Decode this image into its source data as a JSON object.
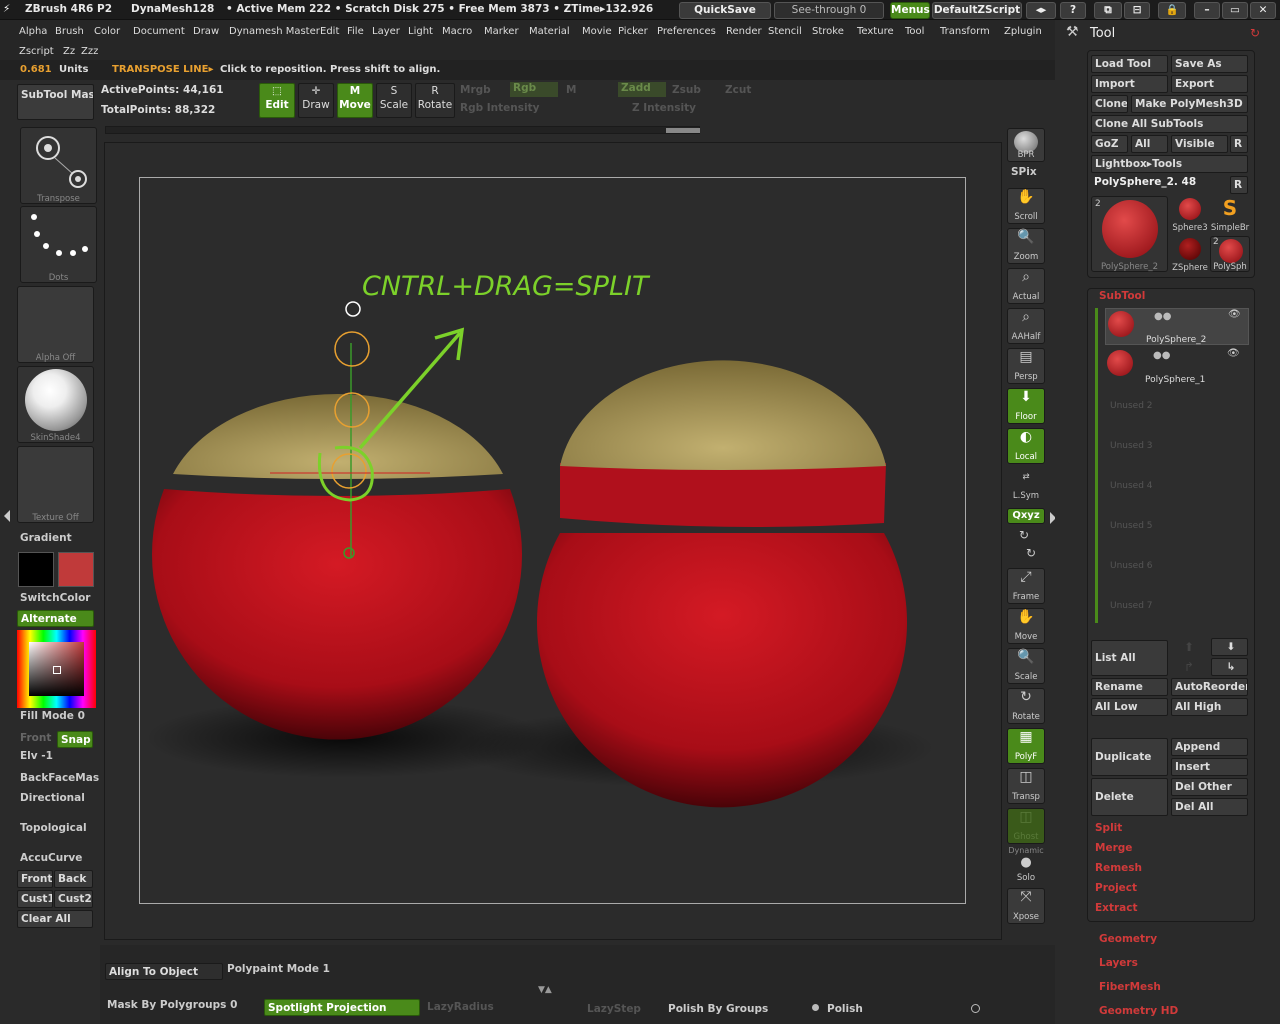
{
  "topbar": {
    "app": "ZBrush 4R6 P2",
    "dyna": "DynaMesh128",
    "stats": "• Active Mem 222 • Scratch Disk 275 • Free Mem 3873 • ZTime▸132.926",
    "quicksave": "QuickSave",
    "seethrough": "See-through  0",
    "menus": "Menus",
    "script": "DefaultZScript"
  },
  "menu": {
    "row1": [
      "Alpha",
      "Brush",
      "Color",
      "Document",
      "Draw",
      "Dynamesh Master",
      "Edit",
      "File",
      "Layer",
      "Light",
      "Macro",
      "Marker",
      "Material",
      "Movie",
      "Picker",
      "Preferences",
      "Render",
      "Stencil",
      "Stroke",
      "Texture",
      "Tool",
      "Transform",
      "Zplugin"
    ],
    "row2": [
      "Zscript",
      "Zz",
      "Zzz"
    ]
  },
  "status": {
    "units_val": "0.681",
    "units": "Units",
    "mode": "TRANSPOSE LINE▸",
    "msg": "Click to reposition. Press shift to align."
  },
  "toolbar": {
    "subtool_master": "SubTool Master",
    "active_points": "ActivePoints: 44,161",
    "total_points": "TotalPoints: 88,322",
    "edit": "Edit",
    "draw": "Draw",
    "move": "Move",
    "scale": "Scale",
    "rotate": "Rotate",
    "mrgb": "Mrgb",
    "rgb": "Rgb",
    "m": "M",
    "zadd": "Zadd",
    "zsub": "Zsub",
    "zcut": "Zcut",
    "rgb_intensity": "Rgb Intensity",
    "z_intensity": "Z Intensity"
  },
  "left": {
    "transpose": "Transpose",
    "dots": "Dots",
    "alpha_off": "Alpha  Off",
    "skinshade": "SkinShade4",
    "texture_off": "Texture  Off",
    "gradient": "Gradient",
    "switchcolor": "SwitchColor",
    "alternate": "Alternate",
    "fill_mode": "Fill Mode 0",
    "front": "Front",
    "snap": "Snap",
    "elv": "Elv -1",
    "backface": "BackFaceMas",
    "directional": "Directional",
    "topological": "Topological",
    "accucurve": "AccuCurve",
    "front2": "Front",
    "back": "Back",
    "cust1": "Cust1",
    "cust2": "Cust2",
    "clear_all": "Clear All",
    "primary_color": "#000000",
    "secondary_color": "#c03a3a"
  },
  "canvas": {
    "annotation": "CNTRL+DRAG=SPLIT",
    "accent": "#7cd12a",
    "sphere": "#b80f1a",
    "cap": "#a7954f"
  },
  "vtools": {
    "bpr": "BPR",
    "spix": "SPix",
    "scroll": "Scroll",
    "zoom": "Zoom",
    "actual": "Actual",
    "aahalf": "AAHalf",
    "persp": "Persp",
    "floor": "Floor",
    "local": "Local",
    "lsym": "L.Sym",
    "xyz": "Qxyz",
    "frame": "Frame",
    "move": "Move",
    "scale": "Scale",
    "rotate": "Rotate",
    "polyf": "PolyF",
    "transp": "Transp",
    "ghost": "Ghost",
    "dynamic": "Dynamic",
    "solo": "Solo",
    "xpose": "Xpose"
  },
  "tool": {
    "title": "Tool",
    "load": "Load Tool",
    "saveas": "Save As",
    "import": "Import",
    "export": "Export",
    "clone": "Clone",
    "make_polymesh": "Make PolyMesh3D",
    "clone_all": "Clone  All SubTools",
    "goz": "GoZ",
    "all": "All",
    "visible": "Visible",
    "r": "R",
    "lightbox": "Lightbox▸Tools",
    "current": "PolySphere_2. 48",
    "thumbs": [
      "PolySphere_2",
      "Sphere3",
      "SimpleBr",
      "ZSphere",
      "PolySph"
    ],
    "thumb_count": "2",
    "subtool": "SubTool",
    "items": [
      "PolySphere_2",
      "PolySphere_1"
    ],
    "unused": [
      "Unused  2",
      "Unused  3",
      "Unused  4",
      "Unused  5",
      "Unused  6",
      "Unused  7"
    ],
    "list_all": "List  All",
    "rename": "Rename",
    "autoreorder": "AutoReorder",
    "all_low": "All Low",
    "all_high": "All High",
    "duplicate": "Duplicate",
    "append": "Append",
    "insert": "Insert",
    "delete": "Delete",
    "del_other": "Del Other",
    "del_all": "Del All",
    "split": "Split",
    "merge": "Merge",
    "remesh": "Remesh",
    "project": "Project",
    "extract": "Extract",
    "sections": [
      "Geometry",
      "Layers",
      "FiberMesh",
      "Geometry HD"
    ]
  },
  "bottom": {
    "align": "Align To Object",
    "polypaint": "Polypaint Mode 1",
    "mask": "Mask By Polygroups 0",
    "spotlight": "Spotlight Projection",
    "lazyradius": "LazyRadius",
    "lazystep": "LazyStep",
    "polish_groups": "Polish By Groups",
    "polish": "Polish"
  }
}
